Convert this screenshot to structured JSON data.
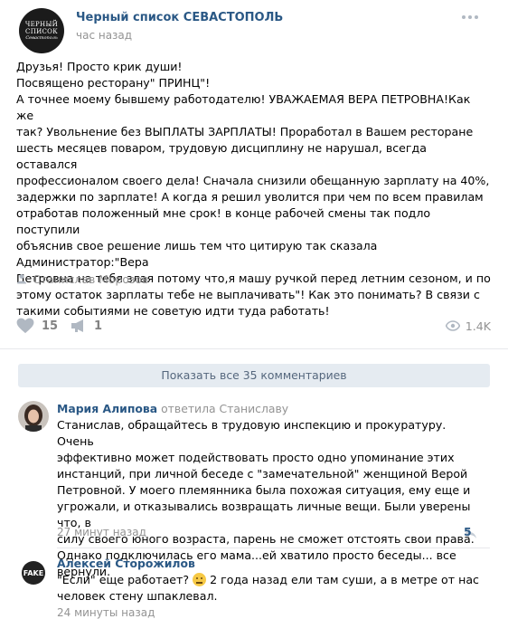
{
  "post": {
    "group_avatar_line1": "ЧЕРНЫЙ",
    "group_avatar_line2": "СПИСОК",
    "group_avatar_line3": "Севастополь",
    "group_name": "Черный список СЕВАСТОПОЛЬ",
    "time": "час назад",
    "text_lines": [
      "Друзья! Просто крик души!",
      "Посвящено ресторану\" ПРИНЦ\"!",
      "А точнее моему бывшему работодателю! УВАЖАЕМАЯ ВЕРА ПЕТРОВНА!Как же",
      "так? Увольнение без ВЫПЛАТЫ ЗАРПЛАТЫ! Проработал в Вашем ресторане",
      "шесть месяцев поваром, трудовую дисциплину не нарушал, всегда оставался",
      "профессионалом своего дела! Сначала снизили обещанную зарплату на 40%,",
      "задержки по зарплате! А когда я решил уволится при чем по всем правилам",
      "отработав положенный мне срок! в конце рабочей смены так подло поступили",
      "объяснив свое решение лишь тем что цитирую так сказала Администратор:\"Вера",
      "Петровна на тебя злая потому что,я машу ручкой перед летним сезоном, и по",
      "этому остаток зарплаты тебе не выплачивать\"! Как это понимать? В связи с",
      "такими событиями не советую идти туда работать!"
    ],
    "signer": "Станислав Морозов",
    "likes": "15",
    "shares": "1",
    "views": "1.4K",
    "icons": {
      "like": "heart-icon",
      "share": "share-megaphone-icon",
      "views": "eye-icon",
      "signer": "person-icon",
      "more": "more-dots-icon"
    }
  },
  "comments_section": {
    "show_all_label": "Показать все 35 комментариев",
    "comments": [
      {
        "author": "Мария Алипова",
        "reply_to": "ответила Станиславу",
        "text_lines": [
          "Станислав, обращайтесь в трудовую инспекцию и прокуратуру. Очень",
          "эффективно может подействовать просто одно упоминание этих",
          "инстанций, при личной беседе с \"замечательной\" женщиной Верой",
          "Петровной. У моего племянника была похожая ситуация, ему еще и",
          "угрожали, и отказывались возвращать личные вещи. Были уверены что, в",
          "силу своего юного возраста, парень не сможет отстоять свои права.",
          "Однако подключилась его мама...ей хватило просто беседы... все вернули."
        ],
        "time": "27 минут назад",
        "likes": "5"
      },
      {
        "author": "Алексей Сторожилов",
        "avatar_text": "FAKE",
        "text_before_emoji": "\"Если\" еще работает?",
        "text_after_emoji": "2 года назад ели там суши, а в метре от нас",
        "text_line2": "человек стену шпаклевал.",
        "time": "24 минуты назад"
      }
    ]
  },
  "colors": {
    "link": "#2a5885",
    "meta": "#939393",
    "button_bg": "#e5ebf1",
    "button_text": "#55677d"
  }
}
